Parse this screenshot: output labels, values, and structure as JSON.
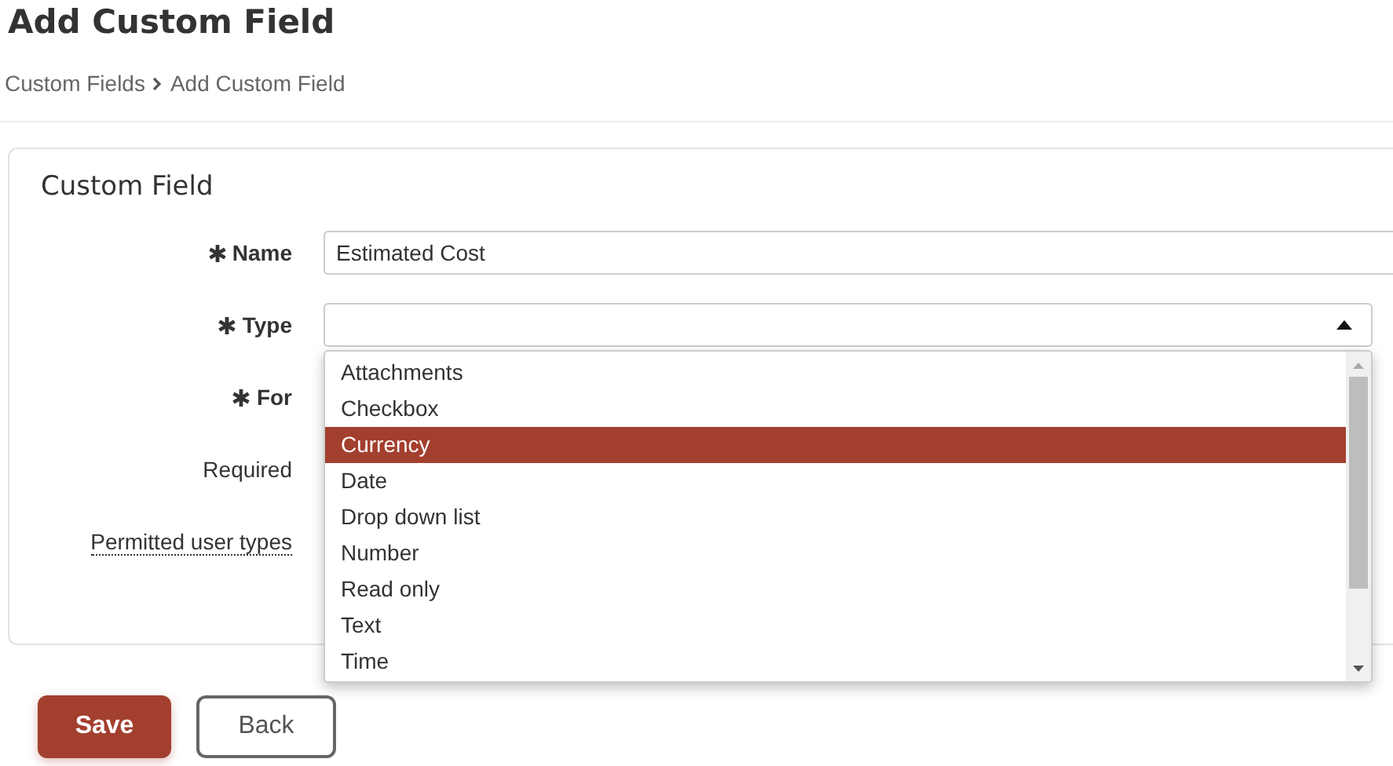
{
  "page_title": "Add Custom Field",
  "breadcrumb": [
    {
      "label": "Custom Fields"
    },
    {
      "label": "Add Custom Field"
    }
  ],
  "card": {
    "title": "Custom Field",
    "fields": [
      {
        "label": "Name",
        "required": true,
        "kind": "text",
        "value": "Estimated Cost"
      },
      {
        "label": "Type",
        "required": true,
        "kind": "select",
        "expanded": true,
        "options": [
          {
            "label": "Attachments",
            "selected": false
          },
          {
            "label": "Checkbox",
            "selected": false
          },
          {
            "label": "Currency",
            "selected": true
          },
          {
            "label": "Date",
            "selected": false
          },
          {
            "label": "Drop down list",
            "selected": false
          },
          {
            "label": "Number",
            "selected": false
          },
          {
            "label": "Read only",
            "selected": false
          },
          {
            "label": "Text",
            "selected": false
          },
          {
            "label": "Time",
            "selected": false
          }
        ]
      },
      {
        "label": "For",
        "required": true,
        "kind": "covered"
      },
      {
        "label": "Required",
        "required": false,
        "kind": "covered"
      },
      {
        "label": "Permitted user types",
        "required": false,
        "kind": "tooltip"
      }
    ]
  },
  "buttons": [
    {
      "label": "Save",
      "kind": "primary"
    },
    {
      "label": "Back",
      "kind": "outline"
    }
  ]
}
